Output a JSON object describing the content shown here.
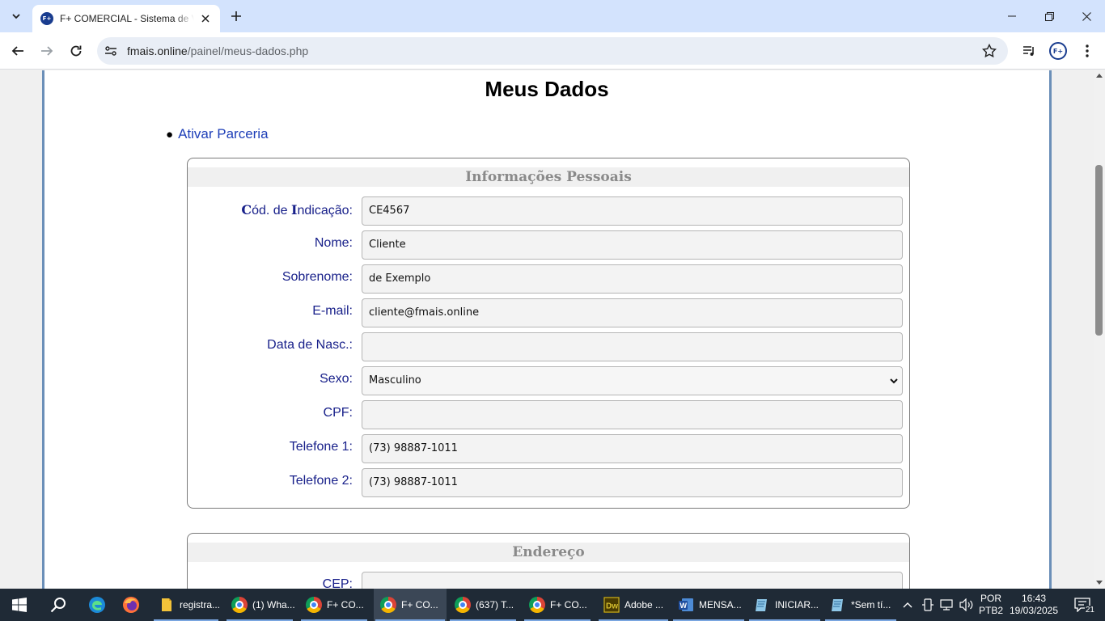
{
  "browser": {
    "tab_title": "F+ COMERCIAL - Sistema de Vendas",
    "favicon_text": "F+",
    "url_host": "fmais.online",
    "url_path": "/painel/meus-dados.php",
    "profile_text": "F+"
  },
  "page": {
    "title": "Meus Dados",
    "partner_link": "Ativar Parceria",
    "personal_section": {
      "legend": "Informações Pessoais",
      "fields": {
        "codigo": {
          "label_c": "C",
          "label_rest1": "ód. de ",
          "label_i": "I",
          "label_rest2": "ndicação:",
          "value": "CE4567"
        },
        "nome": {
          "label": "Nome:",
          "value": "Cliente"
        },
        "sobrenome": {
          "label": "Sobrenome:",
          "value": "de Exemplo"
        },
        "email": {
          "label": "E-mail:",
          "value": "cliente@fmais.online"
        },
        "nascimento": {
          "label": "Data de Nasc.:",
          "value": ""
        },
        "sexo": {
          "label": "Sexo:",
          "value": "Masculino"
        },
        "cpf": {
          "label": "CPF:",
          "value": ""
        },
        "telefone1": {
          "label": "Telefone 1:",
          "value": "(73) 98887-1011"
        },
        "telefone2": {
          "label": "Telefone 2:",
          "value": "(73) 98887-1011"
        }
      }
    },
    "address_section": {
      "legend": "Endereço",
      "first_label": "CEP:"
    }
  },
  "taskbar": {
    "items": [
      {
        "label": "registra...",
        "icon": "folder-icon"
      },
      {
        "label": "(1) Wha...",
        "icon": "chrome-icon"
      },
      {
        "label": "F+ CO...",
        "icon": "chrome-icon"
      },
      {
        "label": "F+ CO...",
        "icon": "chrome-icon"
      },
      {
        "label": "(637) T...",
        "icon": "chrome-icon"
      },
      {
        "label": "F+ CO...",
        "icon": "chrome-icon"
      },
      {
        "label": "Adobe ...",
        "icon": "dreamweaver-icon"
      },
      {
        "label": "MENSA...",
        "icon": "word-icon"
      },
      {
        "label": "INICIAR...",
        "icon": "notepad-icon"
      },
      {
        "label": "*Sem tí...",
        "icon": "notepad-icon"
      }
    ],
    "language": "POR",
    "keyboard": "PTB2",
    "time": "16:43",
    "date": "19/03/2025",
    "notifications": "21"
  },
  "colors": {
    "label": "#18208a",
    "link": "#1e3fb8",
    "legend": "#8a8a8a",
    "panel_border": "#6b8fb8"
  }
}
